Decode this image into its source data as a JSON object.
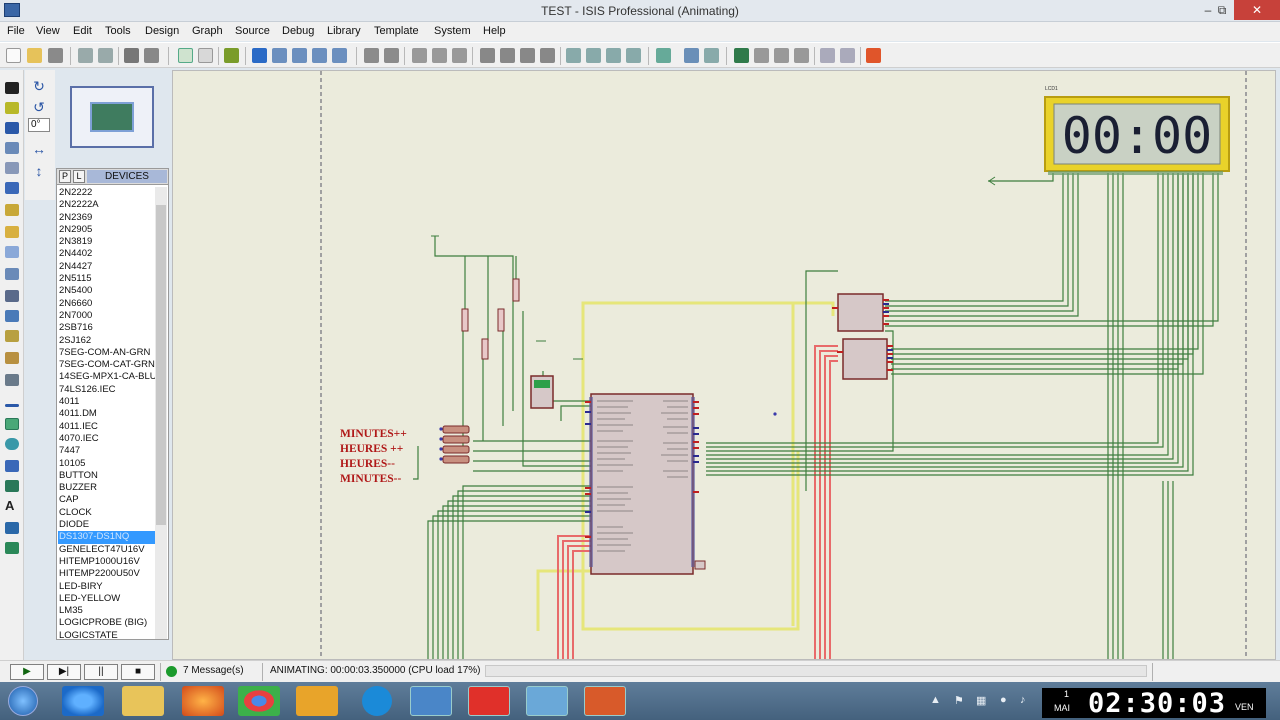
{
  "window": {
    "title": "TEST - ISIS Professional (Animating)",
    "minimize": "–",
    "restore": "⧉",
    "close": "✕"
  },
  "menu": [
    "File",
    "View",
    "Edit",
    "Tools",
    "Design",
    "Graph",
    "Source",
    "Debug",
    "Library",
    "Template",
    "System",
    "Help"
  ],
  "left_tools": {
    "angle_value": "0°"
  },
  "devices": {
    "p_button": "P",
    "l_button": "L",
    "header": "DEVICES",
    "selected": "DS1307-DS1NQ",
    "items": [
      "2N2222",
      "2N2222A",
      "2N2369",
      "2N2905",
      "2N3819",
      "2N4402",
      "2N4427",
      "2N5115",
      "2N5400",
      "2N6660",
      "2N7000",
      "2SB716",
      "2SJ162",
      "7SEG-COM-AN-GRN",
      "7SEG-COM-CAT-GRN",
      "14SEG-MPX1-CA-BLU",
      "74LS126.IEC",
      "4011",
      "4011.DM",
      "4011.IEC",
      "4070.IEC",
      "7447",
      "10105",
      "BUTTON",
      "BUZZER",
      "CAP",
      "CLOCK",
      "DIODE",
      "DS1307-DS1NQ",
      "GENELECT47U16V",
      "HITEMP1000U16V",
      "HITEMP2200U50V",
      "LED-BIRY",
      "LED-YELLOW",
      "LM35",
      "LOGICPROBE (BIG)",
      "LOGICSTATE"
    ]
  },
  "schematic": {
    "display_digits": "00:00",
    "button_labels": [
      "MINUTES++",
      "HEURES ++",
      "HEURES--",
      "MINUTES--"
    ]
  },
  "status": {
    "message_count": "7 Message(s)",
    "animation_status": "ANIMATING: 00:00:03.350000 (CPU load 17%)"
  },
  "taskbar": {
    "clock_day": "1",
    "clock_month": "MAI",
    "clock_time": "02:30:03",
    "clock_weekday": "VEN"
  },
  "colors": {
    "canvas_bg": "#ebebdc",
    "wire_green": "#3d7a3d",
    "wire_red": "#e04848",
    "wire_yellow": "#e8e84a",
    "label_red": "#b01818",
    "lcd_frame": "#e8d22a"
  }
}
